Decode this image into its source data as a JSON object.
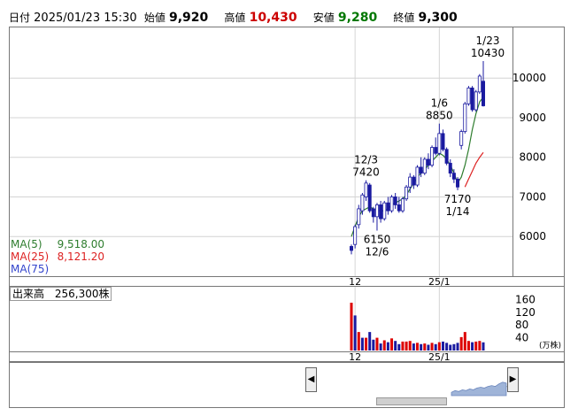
{
  "header": {
    "date_label": "日付",
    "datetime": "2025/01/23 15:30",
    "open_label": "始値",
    "open_value": "9,920",
    "high_label": "高値",
    "high_value": "10,430",
    "low_label": "安値",
    "low_value": "9,280",
    "close_label": "終値",
    "close_value": "9,300",
    "colors": {
      "high": "#cc0000",
      "low": "#007700",
      "text": "#000000"
    }
  },
  "ma_legend": [
    {
      "label": "MA(5)",
      "value": "9,518.00",
      "color": "#2e7d2e"
    },
    {
      "label": "MA(25)",
      "value": "8,121.20",
      "color": "#dd2222"
    },
    {
      "label": "MA(75)",
      "value": "",
      "color": "#3344cc"
    }
  ],
  "volume_legend": {
    "label": "出来高",
    "value": "256,300株"
  },
  "volume_unit": "(万株)",
  "nav_label": "25/",
  "chart_data": {
    "type": "candlestick",
    "x_tick_labels": [
      "12",
      "25/1"
    ],
    "price_axis": {
      "ticks": [
        6000,
        7000,
        8000,
        9000,
        10000
      ],
      "range": [
        5000,
        11300
      ]
    },
    "volume_axis": {
      "ticks": [
        40,
        80,
        120,
        160
      ],
      "range": [
        0,
        200
      ]
    },
    "annotations": [
      {
        "top": "1/23",
        "bottom": "10430"
      },
      {
        "top": "1/6",
        "bottom": "8850"
      },
      {
        "top": "12/3",
        "bottom": "7420"
      },
      {
        "top": "6150",
        "bottom": "12/6"
      },
      {
        "top": "7170",
        "bottom": "1/14"
      }
    ],
    "candles": [
      {
        "o": 5650,
        "h": 5800,
        "l": 5550,
        "c": 5750,
        "color": "#1a1aa0"
      },
      {
        "o": 5800,
        "h": 6300,
        "l": 5700,
        "c": 6250,
        "color": "#ffffff"
      },
      {
        "o": 6300,
        "h": 6800,
        "l": 6200,
        "c": 6700,
        "color": "#ffffff"
      },
      {
        "o": 6650,
        "h": 7100,
        "l": 6550,
        "c": 7050,
        "color": "#ffffff"
      },
      {
        "o": 7000,
        "h": 7420,
        "l": 6900,
        "c": 7350,
        "color": "#ffffff"
      },
      {
        "o": 7300,
        "h": 7350,
        "l": 6600,
        "c": 6650,
        "color": "#1a1aa0"
      },
      {
        "o": 6700,
        "h": 6750,
        "l": 6350,
        "c": 6500,
        "color": "#1a1aa0"
      },
      {
        "o": 6500,
        "h": 6850,
        "l": 6150,
        "c": 6800,
        "color": "#ffffff"
      },
      {
        "o": 6800,
        "h": 6900,
        "l": 6350,
        "c": 6450,
        "color": "#1a1aa0"
      },
      {
        "o": 6450,
        "h": 6900,
        "l": 6400,
        "c": 6850,
        "color": "#ffffff"
      },
      {
        "o": 6850,
        "h": 7000,
        "l": 6550,
        "c": 6650,
        "color": "#1a1aa0"
      },
      {
        "o": 6650,
        "h": 7050,
        "l": 6600,
        "c": 7000,
        "color": "#ffffff"
      },
      {
        "o": 7000,
        "h": 7100,
        "l": 6700,
        "c": 6800,
        "color": "#1a1aa0"
      },
      {
        "o": 6800,
        "h": 7000,
        "l": 6600,
        "c": 6650,
        "color": "#1a1aa0"
      },
      {
        "o": 6650,
        "h": 7000,
        "l": 6600,
        "c": 6950,
        "color": "#ffffff"
      },
      {
        "o": 6950,
        "h": 7300,
        "l": 6900,
        "c": 7250,
        "color": "#ffffff"
      },
      {
        "o": 7250,
        "h": 7600,
        "l": 7100,
        "c": 7500,
        "color": "#ffffff"
      },
      {
        "o": 7500,
        "h": 7550,
        "l": 7200,
        "c": 7300,
        "color": "#1a1aa0"
      },
      {
        "o": 7300,
        "h": 7800,
        "l": 7250,
        "c": 7750,
        "color": "#ffffff"
      },
      {
        "o": 7750,
        "h": 8000,
        "l": 7500,
        "c": 7600,
        "color": "#1a1aa0"
      },
      {
        "o": 7600,
        "h": 8000,
        "l": 7550,
        "c": 7950,
        "color": "#ffffff"
      },
      {
        "o": 7950,
        "h": 8100,
        "l": 7700,
        "c": 7800,
        "color": "#1a1aa0"
      },
      {
        "o": 7800,
        "h": 8300,
        "l": 7750,
        "c": 8250,
        "color": "#ffffff"
      },
      {
        "o": 8250,
        "h": 8500,
        "l": 8050,
        "c": 8100,
        "color": "#1a1aa0"
      },
      {
        "o": 8100,
        "h": 8850,
        "l": 8050,
        "c": 8600,
        "color": "#ffffff"
      },
      {
        "o": 8600,
        "h": 8700,
        "l": 8150,
        "c": 8200,
        "color": "#1a1aa0"
      },
      {
        "o": 8200,
        "h": 8250,
        "l": 7800,
        "c": 7850,
        "color": "#1a1aa0"
      },
      {
        "o": 7850,
        "h": 7950,
        "l": 7500,
        "c": 7600,
        "color": "#1a1aa0"
      },
      {
        "o": 7600,
        "h": 7700,
        "l": 7350,
        "c": 7450,
        "color": "#1a1aa0"
      },
      {
        "o": 7450,
        "h": 7500,
        "l": 7170,
        "c": 7250,
        "color": "#1a1aa0"
      },
      {
        "o": 8300,
        "h": 8700,
        "l": 8200,
        "c": 8650,
        "color": "#ffffff"
      },
      {
        "o": 8650,
        "h": 9400,
        "l": 8600,
        "c": 9350,
        "color": "#ffffff"
      },
      {
        "o": 9350,
        "h": 9800,
        "l": 9300,
        "c": 9750,
        "color": "#ffffff"
      },
      {
        "o": 9750,
        "h": 9800,
        "l": 9150,
        "c": 9200,
        "color": "#1a1aa0"
      },
      {
        "o": 9200,
        "h": 9700,
        "l": 9150,
        "c": 9650,
        "color": "#ffffff"
      },
      {
        "o": 9650,
        "h": 10100,
        "l": 9600,
        "c": 10050,
        "color": "#ffffff"
      },
      {
        "o": 9920,
        "h": 10430,
        "l": 9280,
        "c": 9300,
        "color": "#1a1aa0"
      }
    ],
    "ma5": [
      6000,
      6250,
      6500,
      6650,
      6700,
      6750,
      6700,
      6650,
      6650,
      6650,
      6700,
      6800,
      6850,
      6900,
      6950,
      7050,
      7200,
      7350,
      7500,
      7600,
      7700,
      7800,
      7900,
      8000,
      8100,
      8050,
      7950,
      7800,
      7600,
      7350,
      7500,
      7800,
      8200,
      8700,
      9100,
      9400,
      9518
    ],
    "ma25": [
      7250,
      7450,
      7650,
      7850,
      8000,
      8121
    ],
    "volume_bars": [
      {
        "v": 150,
        "color": "#dd0000"
      },
      {
        "v": 110,
        "color": "#1a1aa0"
      },
      {
        "v": 58,
        "color": "#dd0000"
      },
      {
        "v": 40,
        "color": "#1a1aa0"
      },
      {
        "v": 40,
        "color": "#dd0000"
      },
      {
        "v": 58,
        "color": "#1a1aa0"
      },
      {
        "v": 34,
        "color": "#1a1aa0"
      },
      {
        "v": 40,
        "color": "#dd0000"
      },
      {
        "v": 22,
        "color": "#1a1aa0"
      },
      {
        "v": 32,
        "color": "#dd0000"
      },
      {
        "v": 26,
        "color": "#1a1aa0"
      },
      {
        "v": 38,
        "color": "#dd0000"
      },
      {
        "v": 30,
        "color": "#1a1aa0"
      },
      {
        "v": 20,
        "color": "#1a1aa0"
      },
      {
        "v": 28,
        "color": "#dd0000"
      },
      {
        "v": 28,
        "color": "#dd0000"
      },
      {
        "v": 30,
        "color": "#dd0000"
      },
      {
        "v": 22,
        "color": "#1a1aa0"
      },
      {
        "v": 24,
        "color": "#dd0000"
      },
      {
        "v": 20,
        "color": "#1a1aa0"
      },
      {
        "v": 22,
        "color": "#dd0000"
      },
      {
        "v": 18,
        "color": "#1a1aa0"
      },
      {
        "v": 24,
        "color": "#dd0000"
      },
      {
        "v": 20,
        "color": "#1a1aa0"
      },
      {
        "v": 26,
        "color": "#dd0000"
      },
      {
        "v": 28,
        "color": "#1a1aa0"
      },
      {
        "v": 24,
        "color": "#1a1aa0"
      },
      {
        "v": 18,
        "color": "#1a1aa0"
      },
      {
        "v": 20,
        "color": "#1a1aa0"
      },
      {
        "v": 24,
        "color": "#1a1aa0"
      },
      {
        "v": 42,
        "color": "#dd0000"
      },
      {
        "v": 58,
        "color": "#dd0000"
      },
      {
        "v": 30,
        "color": "#dd0000"
      },
      {
        "v": 26,
        "color": "#1a1aa0"
      },
      {
        "v": 28,
        "color": "#dd0000"
      },
      {
        "v": 30,
        "color": "#dd0000"
      },
      {
        "v": 25.63,
        "color": "#1a1aa0"
      }
    ]
  }
}
